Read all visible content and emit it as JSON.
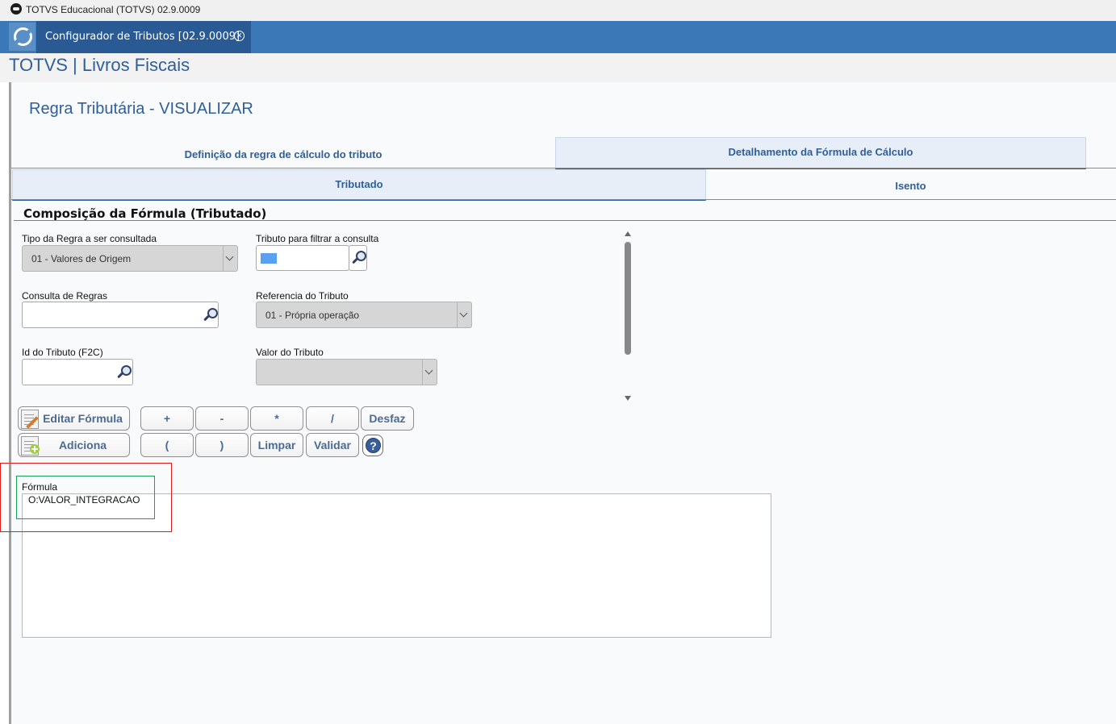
{
  "window": {
    "title": "TOTVS Educacional (TOTVS) 02.9.0009"
  },
  "tabbar": {
    "active_tab": "Configurador de Tributos [02.9.0009]"
  },
  "header": {
    "title": "TOTVS | Livros Fiscais"
  },
  "page": {
    "title": "Regra Tributária - VISUALIZAR"
  },
  "top_tabs": [
    {
      "label": "Definição da regra de cálculo do tributo"
    },
    {
      "label": "Detalhamento da Fórmula de Cálculo"
    }
  ],
  "sub_tabs": [
    {
      "label": "Tributado"
    },
    {
      "label": "Isento"
    }
  ],
  "section": {
    "title": "Composição da Fórmula (Tributado)"
  },
  "fields": {
    "tipo_regra": {
      "label": "Tipo da Regra a ser consultada",
      "value": "01 - Valores de Origem"
    },
    "tributo_filtro": {
      "label": "Tributo para filtrar a consulta",
      "value": ""
    },
    "consulta_regras": {
      "label": "Consulta de Regras",
      "value": ""
    },
    "referencia_tributo": {
      "label": "Referencia do Tributo",
      "value": "01 - Própria operação"
    },
    "id_tributo": {
      "label": "Id do Tributo (F2C)",
      "value": ""
    },
    "valor_tributo": {
      "label": "Valor do Tributo",
      "value": ""
    }
  },
  "buttons": {
    "editar_formula": "Editar Fórmula",
    "adiciona": "Adiciona",
    "plus": "+",
    "minus": "-",
    "multiply": "*",
    "divide": "/",
    "desfaz": "Desfaz",
    "open_paren": "(",
    "close_paren": ")",
    "limpar": "Limpar",
    "validar": "Validar",
    "help": "?"
  },
  "formula": {
    "label": "Fórmula",
    "value": "O:VALOR_INTEGRACAO"
  },
  "colors": {
    "accent": "#2f5f9a",
    "tabbar": "#3b78b8",
    "highlight_red": "#e21b1b",
    "highlight_green": "#18a058"
  }
}
